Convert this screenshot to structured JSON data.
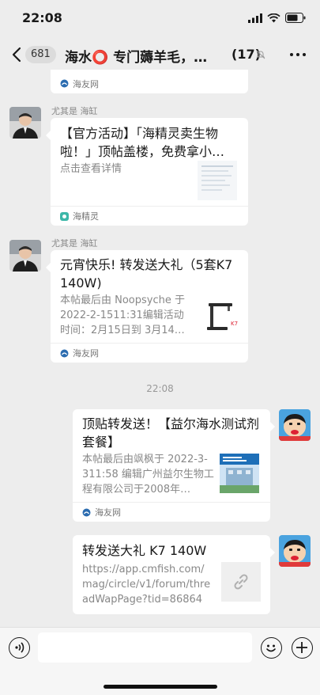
{
  "status_bar": {
    "time": "22:08"
  },
  "nav": {
    "unread_count": "681",
    "title": "海水⭕ 专门薅羊毛，薅…",
    "member_count": "(17)"
  },
  "messages": [
    {
      "type": "card",
      "footer_source": "海友网"
    },
    {
      "type": "card",
      "sender": "尤其是 海缸",
      "title": "【官方活动】「海精灵卖生物啦！」顶帖盖楼，免费拿小…",
      "desc": "点击查看详情",
      "footer_source": "海精灵"
    },
    {
      "type": "card",
      "sender": "尤其是 海缸",
      "title": "元宵快乐! 转发送大礼（5套K7  140W)",
      "desc": "本帖最后由 Noopsyche 于 2022-2-1511:31编辑活动时间：2月15日到 3月14…",
      "footer_source": "海友网"
    },
    {
      "type": "time",
      "text": "22:08"
    },
    {
      "type": "card",
      "title": "顶贴转发送！【益尔海水测试剂套餐】",
      "desc": "本帖最后由飒枫于 2022-3-311:58 编辑广州益尔生物工程有限公司于2008年…",
      "footer_source": "海友网"
    },
    {
      "type": "card",
      "title": "转发送大礼 K7 140W",
      "desc": "https://app.cmfish.com/mag/circle/v1/forum/threadWapPage?tid=868644…"
    }
  ],
  "colors": {
    "background": "#ededed",
    "bubble": "#ffffff",
    "muted_text": "#888888"
  }
}
